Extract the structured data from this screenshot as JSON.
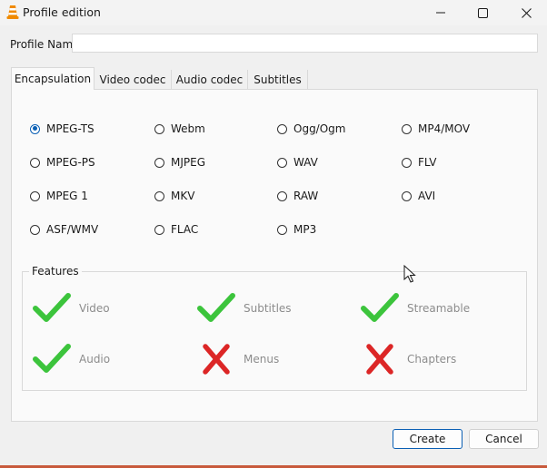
{
  "window": {
    "title": "Profile edition",
    "controls": [
      "minimize-icon",
      "maximize-icon",
      "close-icon"
    ]
  },
  "profile": {
    "label": "Profile Name",
    "value": "",
    "placeholder": ""
  },
  "tabs": [
    {
      "label": "Encapsulation",
      "active": true
    },
    {
      "label": "Video codec",
      "active": false
    },
    {
      "label": "Audio codec",
      "active": false
    },
    {
      "label": "Subtitles",
      "active": false
    }
  ],
  "encapsulation": {
    "options": [
      {
        "label": "MPEG-TS",
        "checked": true
      },
      {
        "label": "Webm",
        "checked": false
      },
      {
        "label": "Ogg/Ogm",
        "checked": false
      },
      {
        "label": "MP4/MOV",
        "checked": false
      },
      {
        "label": "MPEG-PS",
        "checked": false
      },
      {
        "label": "MJPEG",
        "checked": false
      },
      {
        "label": "WAV",
        "checked": false
      },
      {
        "label": "FLV",
        "checked": false
      },
      {
        "label": "MPEG 1",
        "checked": false
      },
      {
        "label": "MKV",
        "checked": false
      },
      {
        "label": "RAW",
        "checked": false
      },
      {
        "label": "AVI",
        "checked": false
      },
      {
        "label": "ASF/WMV",
        "checked": false
      },
      {
        "label": "FLAC",
        "checked": false
      },
      {
        "label": "MP3",
        "checked": false
      }
    ]
  },
  "features": {
    "title": "Features",
    "items": [
      {
        "label": "Video",
        "supported": true
      },
      {
        "label": "Subtitles",
        "supported": true
      },
      {
        "label": "Streamable",
        "supported": true
      },
      {
        "label": "Audio",
        "supported": true
      },
      {
        "label": "Menus",
        "supported": false
      },
      {
        "label": "Chapters",
        "supported": false
      }
    ]
  },
  "buttons": {
    "create": "Create",
    "cancel": "Cancel"
  },
  "colors": {
    "check_green": "#3cc43c",
    "cross_red": "#dc2626",
    "radio_accent": "#0a5fb4",
    "button_focus_border": "#0a5fb4",
    "vlc_orange": "#f08a00"
  }
}
